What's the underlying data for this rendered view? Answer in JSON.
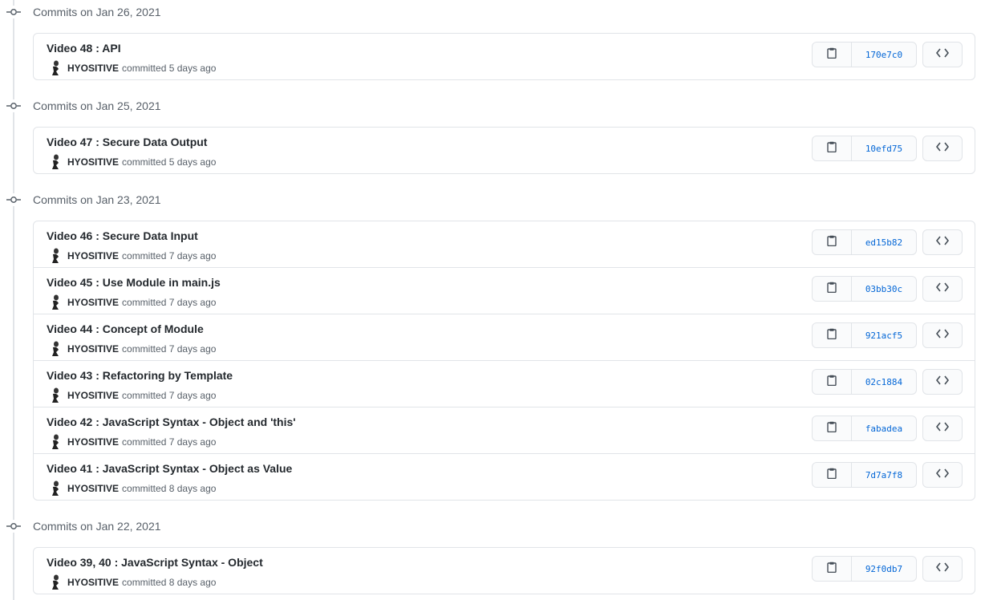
{
  "groups": [
    {
      "title": "Commits on Jan 26, 2021",
      "commits": [
        {
          "message": "Video 48 : API",
          "author": "HYOSITIVE",
          "action": "committed",
          "time": "5 days ago",
          "sha": "170e7c0"
        }
      ]
    },
    {
      "title": "Commits on Jan 25, 2021",
      "commits": [
        {
          "message": "Video 47 : Secure Data Output",
          "author": "HYOSITIVE",
          "action": "committed",
          "time": "5 days ago",
          "sha": "10efd75"
        }
      ]
    },
    {
      "title": "Commits on Jan 23, 2021",
      "commits": [
        {
          "message": "Video 46 : Secure Data Input",
          "author": "HYOSITIVE",
          "action": "committed",
          "time": "7 days ago",
          "sha": "ed15b82"
        },
        {
          "message": "Video 45 : Use Module in main.js",
          "author": "HYOSITIVE",
          "action": "committed",
          "time": "7 days ago",
          "sha": "03bb30c"
        },
        {
          "message": "Video 44 : Concept of Module",
          "author": "HYOSITIVE",
          "action": "committed",
          "time": "7 days ago",
          "sha": "921acf5"
        },
        {
          "message": "Video 43 : Refactoring by Template",
          "author": "HYOSITIVE",
          "action": "committed",
          "time": "7 days ago",
          "sha": "02c1884"
        },
        {
          "message": "Video 42 : JavaScript Syntax - Object and 'this'",
          "author": "HYOSITIVE",
          "action": "committed",
          "time": "7 days ago",
          "sha": "fabadea"
        },
        {
          "message": "Video 41 : JavaScript Syntax - Object as Value",
          "author": "HYOSITIVE",
          "action": "committed",
          "time": "8 days ago",
          "sha": "7d7a7f8"
        }
      ]
    },
    {
      "title": "Commits on Jan 22, 2021",
      "commits": [
        {
          "message": "Video 39, 40 : JavaScript Syntax - Object",
          "author": "HYOSITIVE",
          "action": "committed",
          "time": "8 days ago",
          "sha": "92f0db7"
        }
      ]
    }
  ],
  "icons": {
    "commit": "git-commit-icon",
    "copy": "clipboard-icon",
    "browse": "code-icon",
    "avatar": "user-avatar"
  },
  "colors": {
    "link": "#0366d6",
    "border": "#e1e4e8",
    "muted": "#586069"
  }
}
